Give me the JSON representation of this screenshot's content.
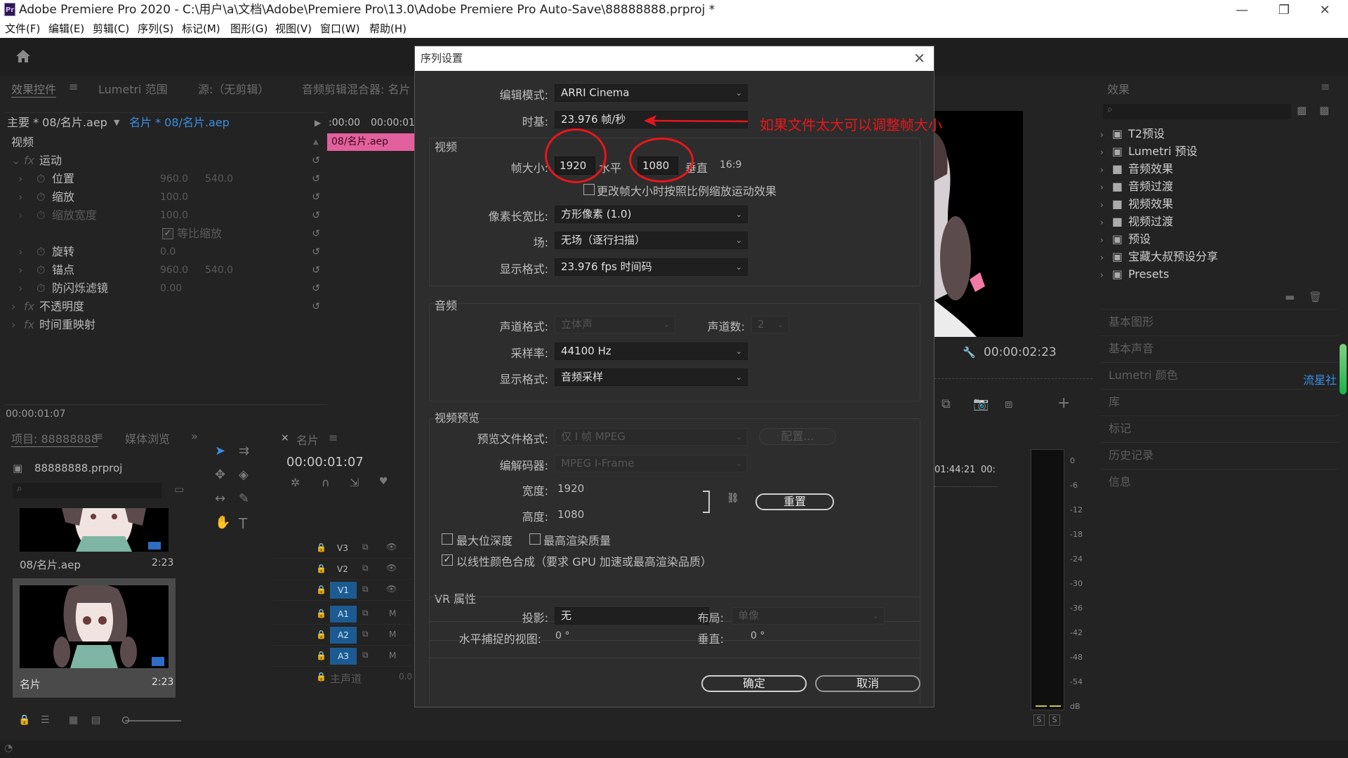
{
  "window": {
    "title": "Adobe Premiere Pro 2020 - C:\\用户\\a\\文档\\Adobe\\Premiere Pro\\13.0\\Adobe Premiere Pro Auto-Save\\88888888.prproj *",
    "logo": "Pr",
    "minimize": "—",
    "restore": "❐",
    "close": "✕"
  },
  "menu": [
    "文件(F)",
    "编辑(E)",
    "剪辑(C)",
    "序列(S)",
    "标记(M)",
    "图形(G)",
    "视图(V)",
    "窗口(W)",
    "帮助(H)"
  ],
  "effect_controls": {
    "tabs": [
      "效果控件",
      "Lumetri 范围",
      "源:（无剪辑）",
      "音频剪辑混合器: 名片"
    ],
    "tab_menu": "≡",
    "master_clip": "主要 * 08/名片.aep",
    "seq_clip": "名片 * 08/名片.aep",
    "time_start": ":00:00",
    "time_next": "00:00:01",
    "clip_bar": "08/名片.aep",
    "video_header": "视频",
    "rows": [
      {
        "name": "运动",
        "fx": "fx"
      },
      {
        "name": "位置",
        "v1": "960.0",
        "v2": "540.0"
      },
      {
        "name": "缩放",
        "v1": "100.0",
        "v2": ""
      },
      {
        "name": "缩放宽度",
        "v1": "100.0",
        "v2": ""
      },
      {
        "name": "等比缩放",
        "v1": "",
        "v2": ""
      },
      {
        "name": "旋转",
        "v1": "0.0",
        "v2": ""
      },
      {
        "name": "锚点",
        "v1": "960.0",
        "v2": "540.0"
      },
      {
        "name": "防闪烁滤镜",
        "v1": "0.00",
        "v2": ""
      },
      {
        "name": "不透明度",
        "fx": "fx"
      },
      {
        "name": "时间重映射",
        "fx": "fx"
      }
    ],
    "timecode": "00:00:01:07"
  },
  "dialog": {
    "title": "序列设置",
    "edit_mode_label": "编辑模式:",
    "edit_mode": "ARRI Cinema",
    "timebase_label": "时基:",
    "timebase": "23.976  帧/秒",
    "video_section": "视频",
    "frame_size_label": "帧大小:",
    "frame_w": "1920",
    "horizontal": "水平",
    "frame_h": "1080",
    "vertical": "垂直",
    "aspect": "16:9",
    "scale_checkbox": "更改帧大小时按照比例缩放运动效果",
    "pixel_aspect_label": "像素长宽比:",
    "pixel_aspect": "方形像素 (1.0)",
    "field_label": "场:",
    "field": "无场（逐行扫描）",
    "display_format_label": "显示格式:",
    "display_format": "23.976 fps 时间码",
    "audio_section": "音频",
    "channel_format_label": "声道格式:",
    "channel_format": "立体声",
    "channels_label": "声道数:",
    "channels": "2",
    "sample_rate_label": "采样率:",
    "sample_rate": "44100 Hz",
    "audio_display_label": "显示格式:",
    "audio_display": "音频采样",
    "preview_section": "视频预览",
    "preview_format_label": "预览文件格式:",
    "preview_format": "仅 I 帧 MPEG",
    "configure": "配置...",
    "codec_label": "编解码器:",
    "codec": "MPEG I-Frame",
    "width_label": "宽度:",
    "width": "1920",
    "height_label": "高度:",
    "height": "1080",
    "link_icon": "⛓",
    "reset": "重置",
    "max_bit_depth": "最大位深度",
    "max_render_quality": "最高渲染质量",
    "linear_color": "以线性颜色合成（要求 GPU 加速或最高渲染品质）",
    "vr_section": "VR 属性",
    "projection_label": "投影:",
    "projection": "无",
    "layout_label": "布局:",
    "layout": "单像",
    "h_view_label": "水平捕捉的视图:",
    "h_view": "0 °",
    "v_label": "垂直:",
    "v_view": "0 °",
    "ok": "确定",
    "cancel": "取消"
  },
  "annotation": {
    "text": "如果文件太大可以调整帧大小",
    "color": "#e8161c"
  },
  "program": {
    "timecode": "00:00:02:23",
    "wrench_icon": "🔧"
  },
  "project": {
    "tabs": [
      "项目: 88888888",
      "媒体浏览"
    ],
    "tab_menu": "≡",
    "file": "88888888.prproj",
    "items": [
      {
        "name": "08/名片.aep",
        "duration": "2:23"
      },
      {
        "name": "名片",
        "duration": "2:23"
      }
    ]
  },
  "timeline": {
    "close": "×",
    "tab": "名片",
    "tab_menu": "≡",
    "timecode": "00:00:01:07",
    "ruler_a": "01:44:21",
    "ruler_b": "00:",
    "tracks": [
      "V3",
      "V2",
      "V1",
      "A1",
      "A2",
      "A3"
    ],
    "track_m": "M",
    "master_label": "主声道",
    "master_value": "0.0"
  },
  "meter": {
    "ticks": [
      "0",
      "-6",
      "-12",
      "-18",
      "-24",
      "-30",
      "-36",
      "-42",
      "-48",
      "-54",
      "dB"
    ],
    "solo": "S"
  },
  "effects_panel": {
    "title": "效果",
    "tab_menu": "≡",
    "items": [
      "T2预设",
      "Lumetri 预设",
      "音频效果",
      "音频过渡",
      "视频效果",
      "视频过渡",
      "预设",
      "宝藏大叔预设分享",
      "Presets"
    ],
    "sections": [
      "基本图形",
      "基本声音",
      "Lumetri 颜色",
      "库",
      "标记",
      "历史记录",
      "信息"
    ],
    "overlay_text": "流星社"
  }
}
